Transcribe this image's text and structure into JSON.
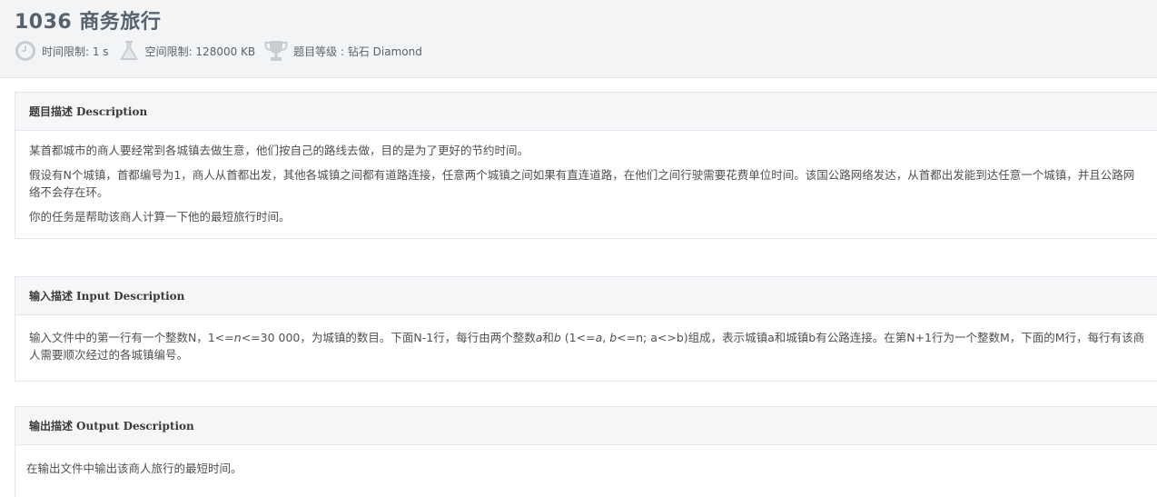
{
  "problem": {
    "title": "1036 商务旅行",
    "time_limit": "时间限制: 1 s",
    "memory_limit": "空间限制: 128000 KB",
    "level": "题目等级 : 钻石 Diamond"
  },
  "sections": {
    "description": {
      "heading_cn": "题目描述",
      "heading_en": "Description",
      "p1": "某首都城市的商人要经常到各城镇去做生意，他们按自己的路线去做，目的是为了更好的节约时间。",
      "p2": "假设有N个城镇，首都编号为1，商人从首都出发，其他各城镇之间都有道路连接，任意两个城镇之间如果有直连道路，在他们之间行驶需要花费单位时间。该国公路网络发达，从首都出发能到达任意一个城镇，并且公路网络不会存在环。",
      "p3": "你的任务是帮助该商人计算一下他的最短旅行时间。"
    },
    "input": {
      "heading_cn": "输入描述",
      "heading_en": "Input Description",
      "t1": "输入文件中的第一行有一个整数N，1<=",
      "n_var": "n",
      "t2": "<=30 000，为城镇的数目。下面N-1行，每行由两个整数",
      "a_var": "a",
      "t3": "和",
      "b_var": "b",
      "t4": " (1<=",
      "a_var2": "a",
      "t5": ", ",
      "b_var2": "b",
      "t6": "<=n; a<>b)组成，表示城镇a和城镇b有公路连接。在第N+1行为一个整数M，下面的M行，每行有该商人需要顺次经过的各城镇编号。"
    },
    "output": {
      "heading_cn": "输出描述",
      "heading_en": "Output Description",
      "p1": "在输出文件中输出该商人旅行的最短时间。"
    }
  },
  "icons": {
    "time": "clock-icon",
    "memory": "flask-icon",
    "level": "trophy-icon"
  },
  "colors": {
    "icon_gray": "#c9cdd1",
    "title": "#56636e"
  }
}
